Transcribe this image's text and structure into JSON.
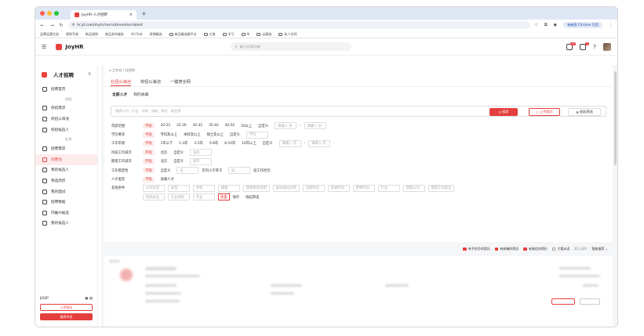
{
  "browser": {
    "tab_title": "JoyHR-人才招聘",
    "url": "hr.jd.com/myhr/recruitment/es-talent",
    "chrome_label": "有新版 Chrome 可用",
    "bookmarks": [
      "品牌运营任务",
      "规则手册",
      "新品规则",
      "商品发布服务",
      "AI Chat",
      "采销精选"
    ],
    "bookmark_folders": [
      "商品精选服平台",
      "工具",
      "学习",
      "AI",
      "云服务",
      "私人空间"
    ]
  },
  "header": {
    "brand": "JoyHR",
    "search_placeholder": "输入应用/功能",
    "badge_1": "27",
    "badge_2": "1"
  },
  "sidebar": {
    "title": "人才招聘",
    "items": [
      {
        "label": "招聘首页"
      },
      {
        "group": "校园"
      },
      {
        "label": "校招需求"
      },
      {
        "label": "校招公海池"
      },
      {
        "label": "校招候选人"
      },
      {
        "group": "社招"
      },
      {
        "label": "招聘需求"
      },
      {
        "label": "优聘池",
        "active": true
      },
      {
        "label": "我的候选人"
      },
      {
        "label": "筛选简历"
      },
      {
        "label": "我的面试"
      },
      {
        "label": "招聘数据"
      },
      {
        "label": "内推AI候选"
      },
      {
        "label": "我的候选人"
      }
    ],
    "footer_label": "JISSP",
    "upload_button": "上传简历",
    "ai_button": "推荐AI员"
  },
  "main": {
    "breadcrumb": [
      "工作台",
      "社招库"
    ],
    "tabs": [
      "社招公海池",
      "校招公海池",
      "一键搜全网"
    ],
    "subtabs": [
      "全部人才",
      "我的收藏"
    ],
    "search_placeholder": "搜索公司、行业、学校、技能、职位、职业等",
    "search_button": "搜索",
    "upload_button": "上传简历",
    "collapse_button": "收起筛选",
    "filters": [
      {
        "label": "年龄范围",
        "options": [
          "不限",
          "20-25",
          "25-30",
          "30-35",
          "35-40",
          "40-50",
          "50以上",
          "自定义"
        ],
        "inputs": [
          "请输入 岁",
          "请输入 岁"
        ]
      },
      {
        "label": "学历要求",
        "options": [
          "不限",
          "专科及以上",
          "本科及以上",
          "硕士及以上",
          "自定义"
        ],
        "inputs": [
          "学历"
        ]
      },
      {
        "label": "工作年限",
        "options": [
          "不限",
          "1年以下",
          "1-3年",
          "3-5年",
          "5-8年",
          "8-10年",
          "10年以上",
          "自定义"
        ],
        "inputs": [
          "请输入 年",
          "请输入 年"
        ]
      },
      {
        "label": "目前工作城市",
        "options": [
          "不限",
          "北京",
          "自定义"
        ],
        "inputs": [
          "城市"
        ]
      },
      {
        "label": "期望工作城市",
        "options": [
          "不限",
          "北京",
          "自定义"
        ],
        "inputs": [
          "城市"
        ]
      },
      {
        "label": "工作稳定性",
        "options": [
          "不限",
          "自定义"
        ],
        "inputs": [
          "近",
          "年内小于等于",
          "段"
        ],
        "suffix": "段工作经历"
      },
      {
        "label": "人才类型",
        "options": [
          "不限",
          "高端人才"
        ],
        "inputs": []
      },
      {
        "label": "其他条件",
        "options": [],
        "inputs": [
          "公司标签",
          "标签",
          "手机",
          "邮箱",
          "期望薪资范围",
          "面试通过比例",
          "活跃时间",
          "投递时间",
          "更新时间",
          "行业",
          "曾职公司",
          "期望工作职位"
        ]
      }
    ],
    "filters_row2": [
      "院校标签",
      "毕业院校",
      "专业"
    ],
    "reset_label": "重置",
    "save_label": "保存",
    "more_label": "收起筛选"
  },
  "sortbar": {
    "options": [
      "有手机号的简历",
      "有邮箱的简历",
      "有微信的简历",
      "只看未读"
    ],
    "sort_label": "默认排序",
    "sort_value": "智能推荐"
  }
}
